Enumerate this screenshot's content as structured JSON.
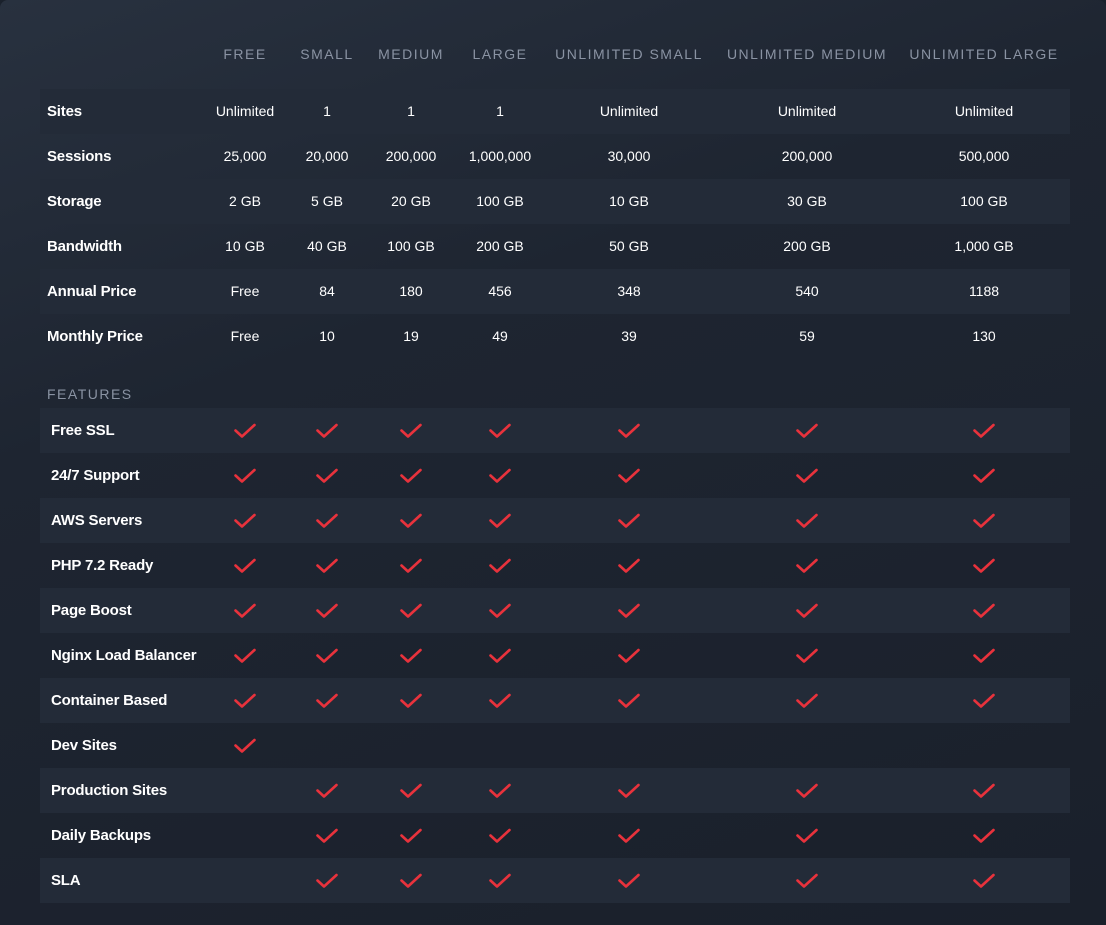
{
  "plans": [
    "FREE",
    "SMALL",
    "MEDIUM",
    "LARGE",
    "UNLIMITED SMALL",
    "UNLIMITED MEDIUM",
    "UNLIMITED LARGE"
  ],
  "specs": [
    {
      "label": "Sites",
      "values": [
        "Unlimited",
        "1",
        "1",
        "1",
        "Unlimited",
        "Unlimited",
        "Unlimited"
      ]
    },
    {
      "label": "Sessions",
      "values": [
        "25,000",
        "20,000",
        "200,000",
        "1,000,000",
        "30,000",
        "200,000",
        "500,000"
      ]
    },
    {
      "label": "Storage",
      "values": [
        "2 GB",
        "5 GB",
        "20 GB",
        "100 GB",
        "10 GB",
        "30 GB",
        "100 GB"
      ]
    },
    {
      "label": "Bandwidth",
      "values": [
        "10 GB",
        "40 GB",
        "100 GB",
        "200 GB",
        "50 GB",
        "200 GB",
        "1,000 GB"
      ]
    },
    {
      "label": "Annual Price",
      "values": [
        "Free",
        "84",
        "180",
        "456",
        "348",
        "540",
        "1188"
      ]
    },
    {
      "label": "Monthly Price",
      "values": [
        "Free",
        "10",
        "19",
        "49",
        "39",
        "59",
        "130"
      ]
    }
  ],
  "features_title": "FEATURES",
  "features": [
    {
      "label": "Free SSL",
      "included": [
        true,
        true,
        true,
        true,
        true,
        true,
        true
      ]
    },
    {
      "label": "24/7 Support",
      "included": [
        true,
        true,
        true,
        true,
        true,
        true,
        true
      ]
    },
    {
      "label": "AWS Servers",
      "included": [
        true,
        true,
        true,
        true,
        true,
        true,
        true
      ]
    },
    {
      "label": "PHP 7.2 Ready",
      "included": [
        true,
        true,
        true,
        true,
        true,
        true,
        true
      ]
    },
    {
      "label": "Page Boost",
      "included": [
        true,
        true,
        true,
        true,
        true,
        true,
        true
      ]
    },
    {
      "label": "Nginx Load Balancer",
      "included": [
        true,
        true,
        true,
        true,
        true,
        true,
        true
      ]
    },
    {
      "label": "Container Based",
      "included": [
        true,
        true,
        true,
        true,
        true,
        true,
        true
      ]
    },
    {
      "label": "Dev Sites",
      "included": [
        true,
        false,
        false,
        false,
        false,
        false,
        false
      ]
    },
    {
      "label": "Production Sites",
      "included": [
        false,
        true,
        true,
        true,
        true,
        true,
        true
      ]
    },
    {
      "label": "Daily Backups",
      "included": [
        false,
        true,
        true,
        true,
        true,
        true,
        true
      ]
    },
    {
      "label": "SLA",
      "included": [
        false,
        true,
        true,
        true,
        true,
        true,
        true
      ]
    }
  ],
  "icons": {
    "check": "check-icon"
  },
  "colors": {
    "check": "#e8323c",
    "row_shade": "#232b38",
    "header_text": "#8a93a3"
  }
}
